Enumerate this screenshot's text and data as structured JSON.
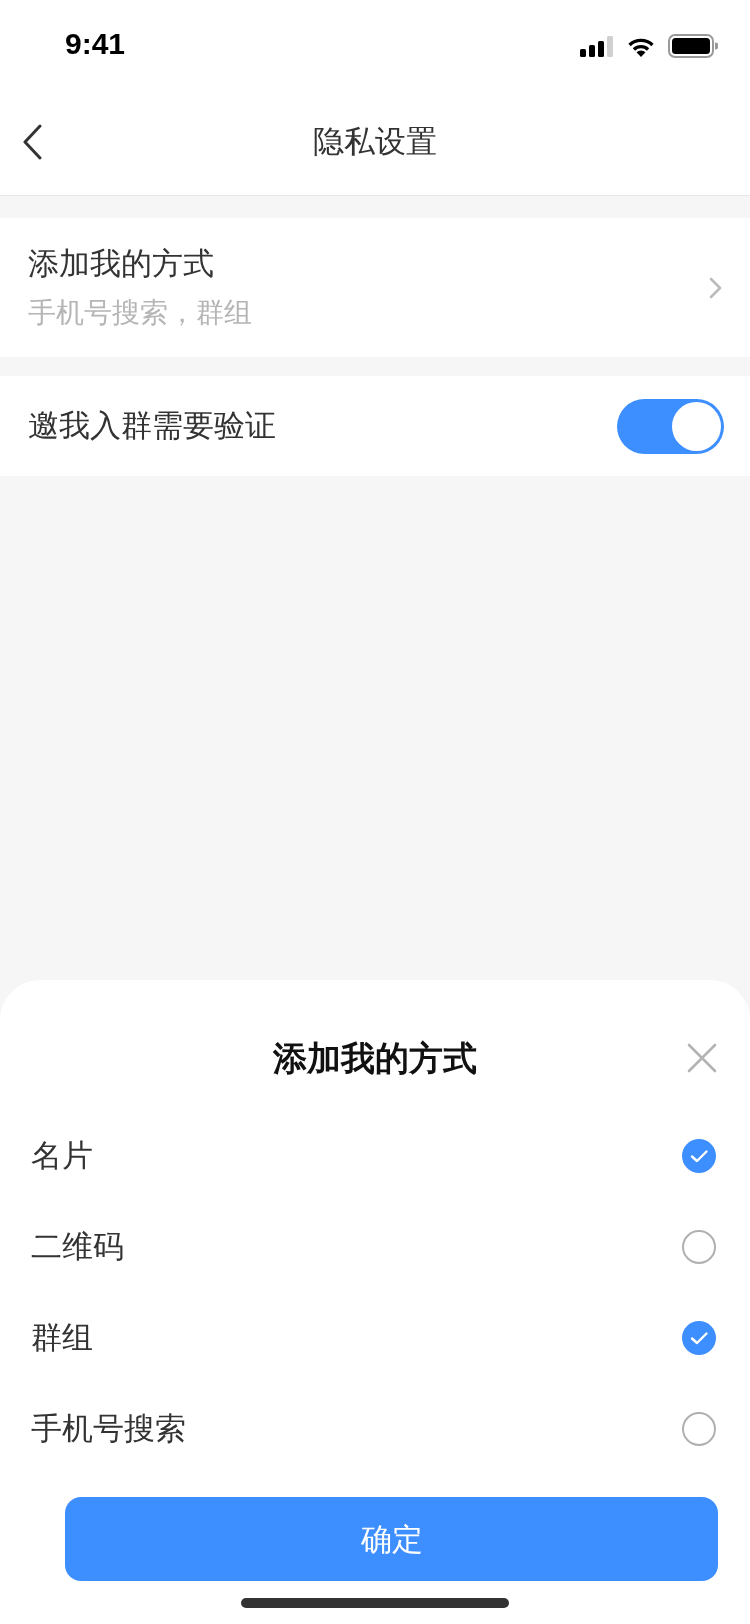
{
  "status_bar": {
    "time": "9:41"
  },
  "nav": {
    "title": "隐私设置"
  },
  "settings": [
    {
      "kind": "link",
      "title": "添加我的方式",
      "subtitle": "手机号搜索，群组"
    },
    {
      "kind": "toggle",
      "title": "邀我入群需要验证",
      "on": true
    }
  ],
  "sheet": {
    "title": "添加我的方式",
    "options": [
      {
        "label": "名片",
        "checked": true
      },
      {
        "label": "二维码",
        "checked": false
      },
      {
        "label": "群组",
        "checked": true
      },
      {
        "label": "手机号搜索",
        "checked": false
      }
    ],
    "confirm": "确定"
  }
}
